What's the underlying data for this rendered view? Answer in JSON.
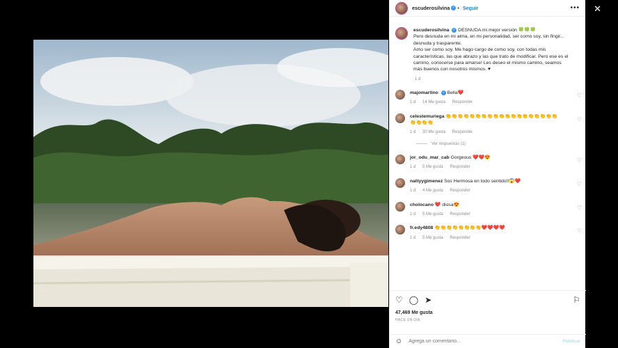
{
  "post": {
    "username": "escuderosilvina",
    "follow_label": "Seguir",
    "caption_title": "DESNUDA mi mejor versión 🍀🍀🍀",
    "caption_lines": [
      "Pero desnuda en mi alma, en mi personalidad, ser como soy, sin fingir... desnuda y trasparente.",
      "Amo ser como soy. Me hago cargo de como soy, con todas mis características, las que abrazo y las que trato de modificar. Pero ese es el camino, conocerse para amarse! Les deseo el mismo camino, seamos más buenos con nosotros mismos. ♥"
    ],
    "caption_time": "1 d",
    "likes": "47,469 Me gusta",
    "posted_ago": "HACE UN DÍA"
  },
  "comments": [
    {
      "user": "majomartino",
      "verified": true,
      "text": "Bella❤️",
      "time": "1 d",
      "likes": "14 Me gusta",
      "reply": "Responder"
    },
    {
      "user": "celestemuriega",
      "verified": false,
      "text": "👏👏👏👏👏👏👏👏👏👏👏👏👏👏👏👏👏👏👏👏👏👏👏",
      "time": "1 d",
      "likes": "30 Me gusta",
      "reply": "Responder",
      "replies": "Ver respuestas (1)"
    },
    {
      "user": "jor_odu_mar_cab",
      "verified": false,
      "text": "Gorgeous ❤️❤️😍",
      "time": "1 d",
      "likes": "5 Me gusta",
      "reply": "Responder"
    },
    {
      "user": "nattyygimenez",
      "verified": false,
      "text": "Sos Hermosa en todo sentido!!😱❤️",
      "time": "1 d",
      "likes": "4 Me gusta",
      "reply": "Responder"
    },
    {
      "user": "cholocano",
      "verified": false,
      "text": "❤️ diosa😍",
      "time": "1 d",
      "likes": "5 Me gusta",
      "reply": "Responder"
    },
    {
      "user": "fr.edy4808",
      "verified": false,
      "text": "👏👏👏👏👏👏👏👏❤️❤️❤️❤️",
      "time": "1 d",
      "likes": "5 Me gusta",
      "reply": "Responder"
    }
  ],
  "composer": {
    "placeholder": "Agrega un comentario...",
    "publish_label": "Publicar"
  },
  "colors": {
    "link": "#0095f6",
    "verified": "#3897f0",
    "muted": "#8e8e8e"
  }
}
